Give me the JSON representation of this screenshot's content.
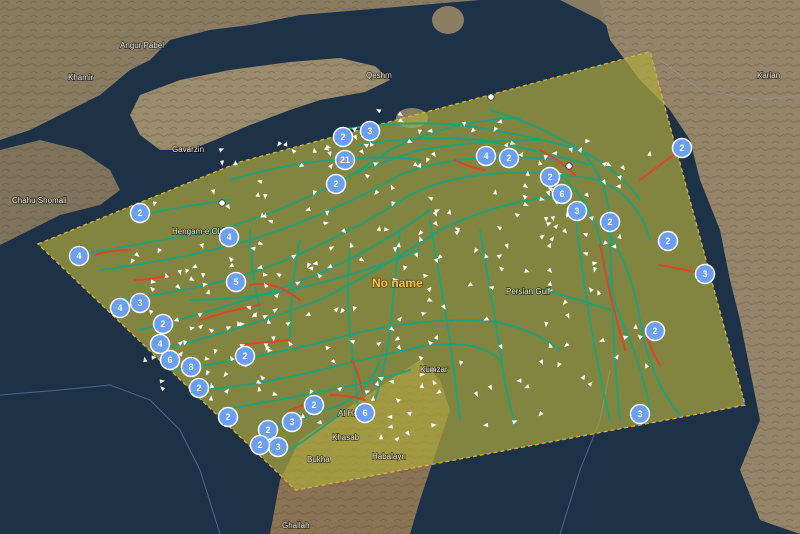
{
  "map": {
    "place_labels": {
      "angur_pabel": "Angur Pabel",
      "khamir": "Khamir",
      "qeshm": "Qeshm",
      "gavarzin": "Gavarzin",
      "chahu_shomali": "Chahu Shomali",
      "hengam": "Hengam-e Old",
      "karian": "Karian",
      "kumzar": "Kumzar",
      "al_harf": "Al Harf",
      "khasab": "Khasab",
      "habalayn": "Habalayn",
      "bukha": "Bukha",
      "ghallah": "Ghallah",
      "persian_gulf": "Persian Gulf"
    },
    "zone": {
      "label": "No name",
      "fill_color": "#e9d65a",
      "border_color": "#e8b94a"
    },
    "colors": {
      "track": "#1fa37c",
      "highlight_track": "#e2432b",
      "cluster": "#6a9ff2",
      "vessel_marker": "#ffffff"
    },
    "clusters": [
      {
        "count": "2"
      },
      {
        "count": "3"
      },
      {
        "count": "21"
      },
      {
        "count": "2"
      },
      {
        "count": "4"
      },
      {
        "count": "2"
      },
      {
        "count": "2"
      },
      {
        "count": "6"
      },
      {
        "count": "3"
      },
      {
        "count": "2"
      },
      {
        "count": "2"
      },
      {
        "count": "3"
      },
      {
        "count": "2"
      },
      {
        "count": "2"
      },
      {
        "count": "4"
      },
      {
        "count": "5"
      },
      {
        "count": "4"
      },
      {
        "count": "3"
      },
      {
        "count": "2"
      },
      {
        "count": "4"
      },
      {
        "count": "4"
      },
      {
        "count": "6"
      },
      {
        "count": "2"
      },
      {
        "count": "8"
      },
      {
        "count": "2"
      },
      {
        "count": "2"
      },
      {
        "count": "2"
      },
      {
        "count": "3"
      },
      {
        "count": "6"
      },
      {
        "count": "2"
      },
      {
        "count": "3"
      },
      {
        "count": "2"
      },
      {
        "count": "2"
      },
      {
        "count": "3"
      }
    ]
  }
}
